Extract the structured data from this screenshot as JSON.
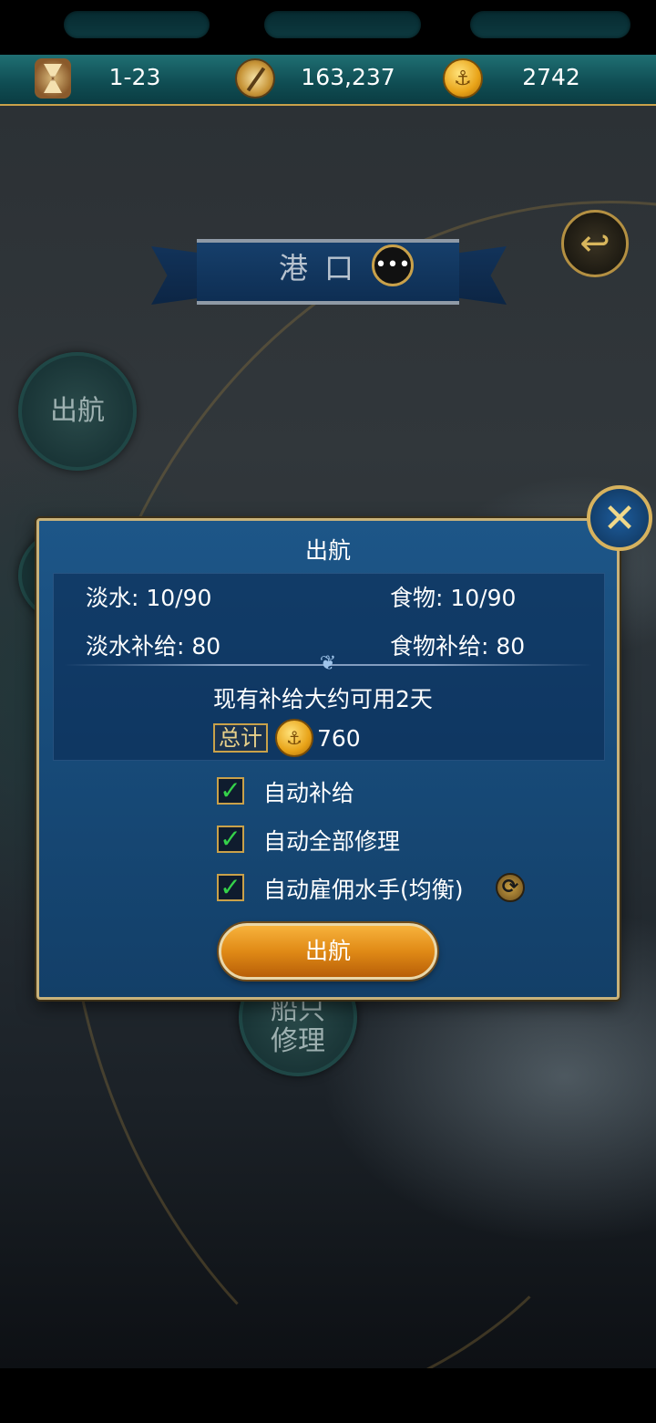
{
  "resources": {
    "time": "1-23",
    "silver": "163,237",
    "gold": "2742"
  },
  "port": {
    "title": "港口"
  },
  "side_buttons": {
    "sail": "出航",
    "partial": "",
    "repair": "船只\n修理"
  },
  "dialog": {
    "title": "出航",
    "water": "淡水: 10/90",
    "food": "食物: 10/90",
    "water_supply": "淡水补给: 80",
    "food_supply": "食物补给: 80",
    "days_estimate": "现有补给大约可用2天",
    "total_label": "总计",
    "total_cost": "760",
    "options": [
      {
        "label": "自动补给",
        "checked": true
      },
      {
        "label": "自动全部修理",
        "checked": true
      },
      {
        "label": "自动雇佣水手(均衡)",
        "checked": true
      }
    ],
    "confirm_button": "出航"
  },
  "colors": {
    "dialog_bg": "#174a78",
    "gold_border": "#c8b27a",
    "button_orange": "#e08a16",
    "check_green": "#35d24a"
  }
}
